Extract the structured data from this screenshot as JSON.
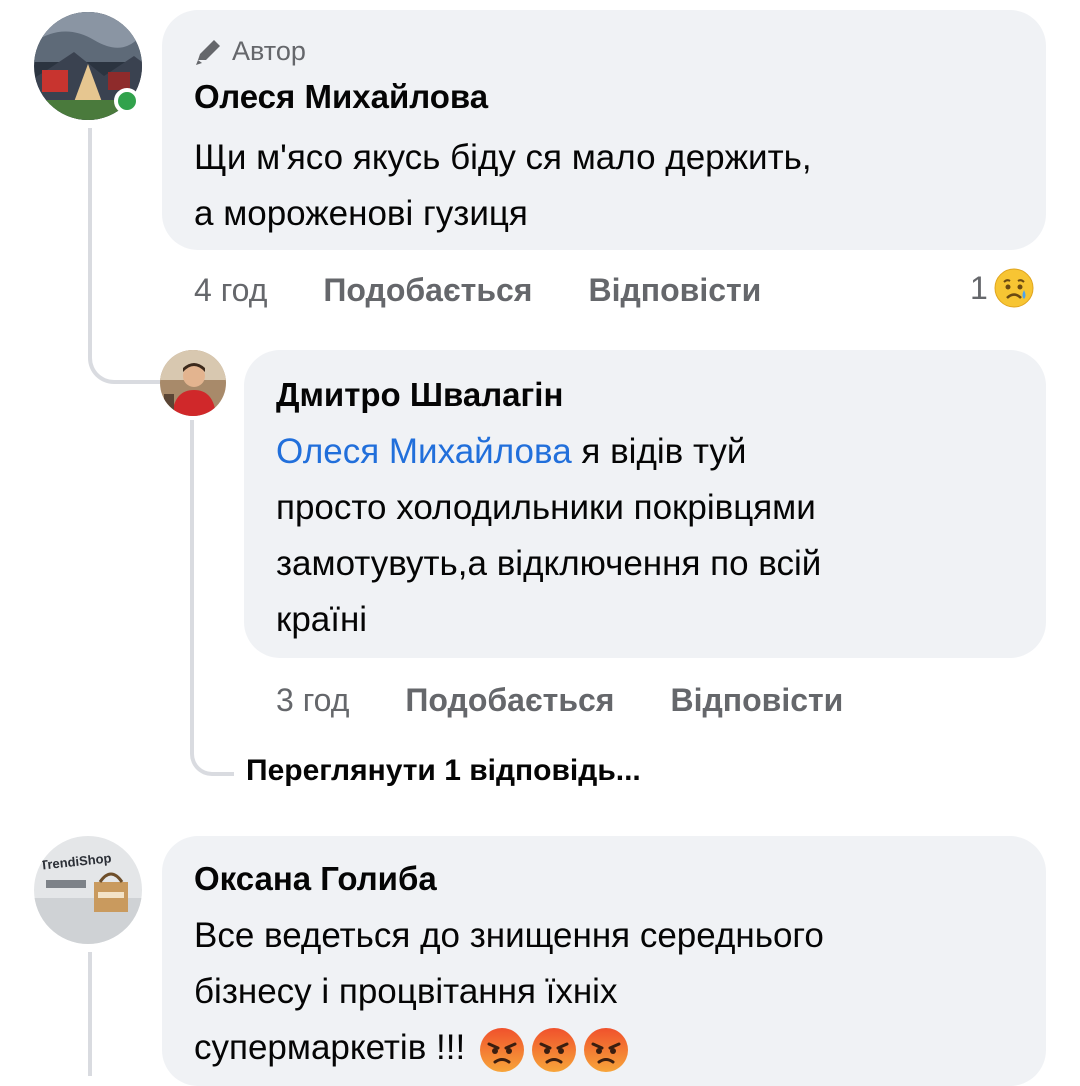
{
  "comments": [
    {
      "badge": "Автор",
      "author": "Олеся Михайлова",
      "lines": [
        "Щи м'ясо якусь біду ся мало держить,",
        "а мороженові гузиця"
      ],
      "time": "4 год",
      "like_label": "Подобається",
      "reply_label": "Відповісти",
      "reaction_count": "1",
      "reaction_icon": "sad-emoji-icon",
      "online": true
    },
    {
      "author": "Дмитро Швалагін",
      "mention": "Олеся Михайлова",
      "line1_rest": " я відів туй",
      "lines": [
        "просто холодильники покрівцями",
        "замотувуть,а відключення по всій",
        "країні"
      ],
      "time": "3 год",
      "like_label": "Подобається",
      "reply_label": "Відповісти",
      "view_replies": "Переглянути 1 відповідь..."
    },
    {
      "author": "Оксана Голиба",
      "lines": [
        "Все ведеться до знищення середнього",
        "бізнесу і процвітання їхніх",
        "супермаркетів !!!"
      ],
      "avatar_text": "TrendiShop",
      "emojis": [
        "angry-emoji-icon",
        "angry-emoji-icon",
        "angry-emoji-icon"
      ]
    }
  ],
  "colors": {
    "bubble": "#f0f2f5",
    "mention": "#216fdb",
    "online": "#31a24c",
    "muted": "#65676b"
  }
}
